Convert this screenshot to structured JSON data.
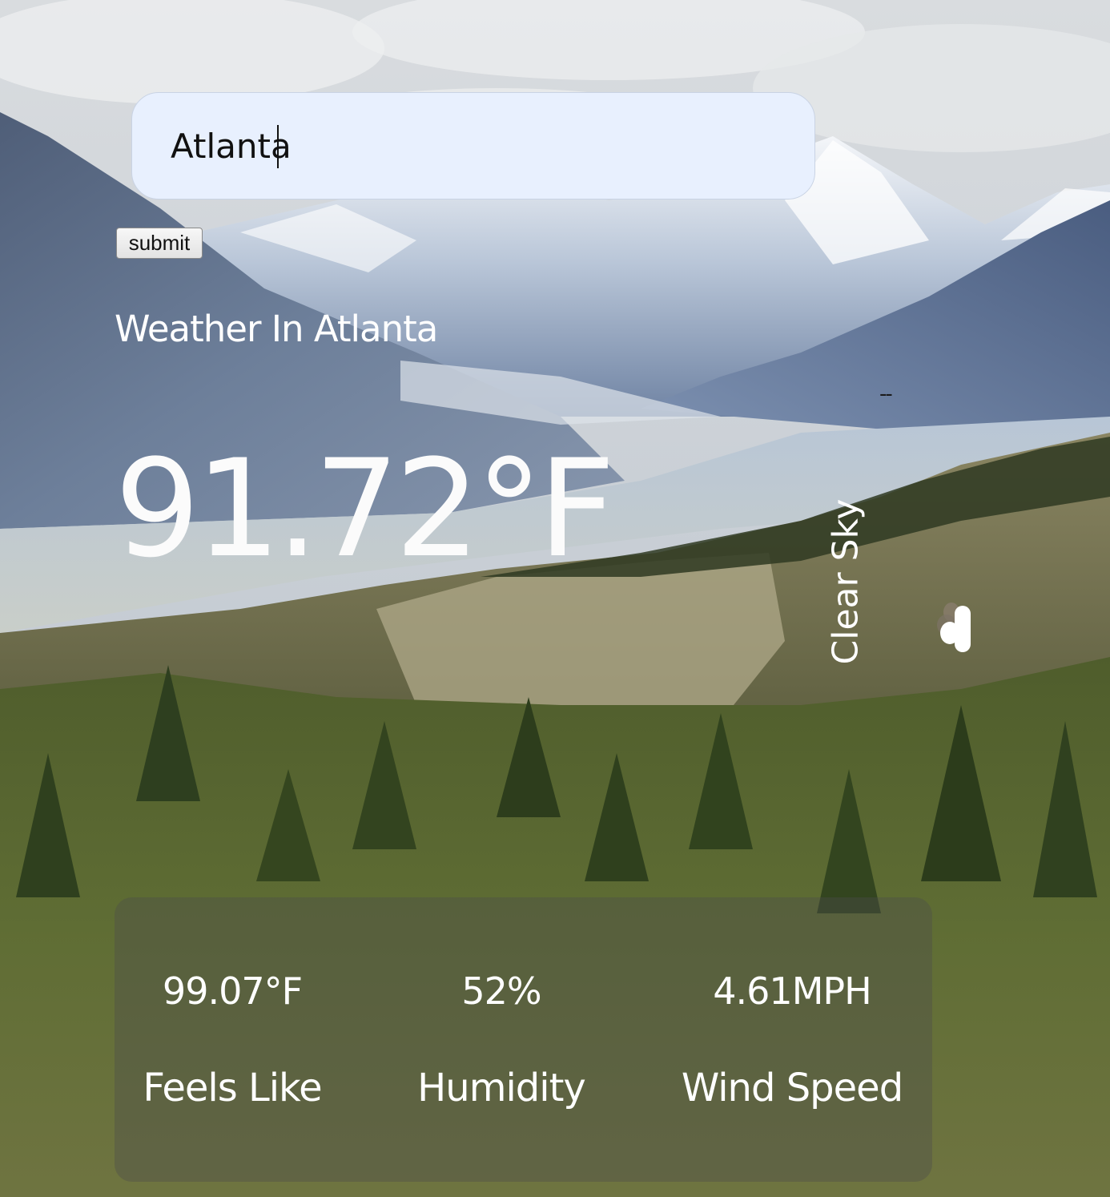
{
  "search": {
    "value": "Atlanta",
    "submit_label": "submit"
  },
  "weather": {
    "title": "Weather In Atlanta",
    "temperature": "91.72°F",
    "placeholder_dash": "--",
    "condition": "Clear Sky",
    "icon": "cloud-icon"
  },
  "details": [
    {
      "value": "99.07°F",
      "label": "Feels Like"
    },
    {
      "value": "52%",
      "label": "Humidity"
    },
    {
      "value": "4.61MPH",
      "label": "Wind Speed"
    }
  ]
}
